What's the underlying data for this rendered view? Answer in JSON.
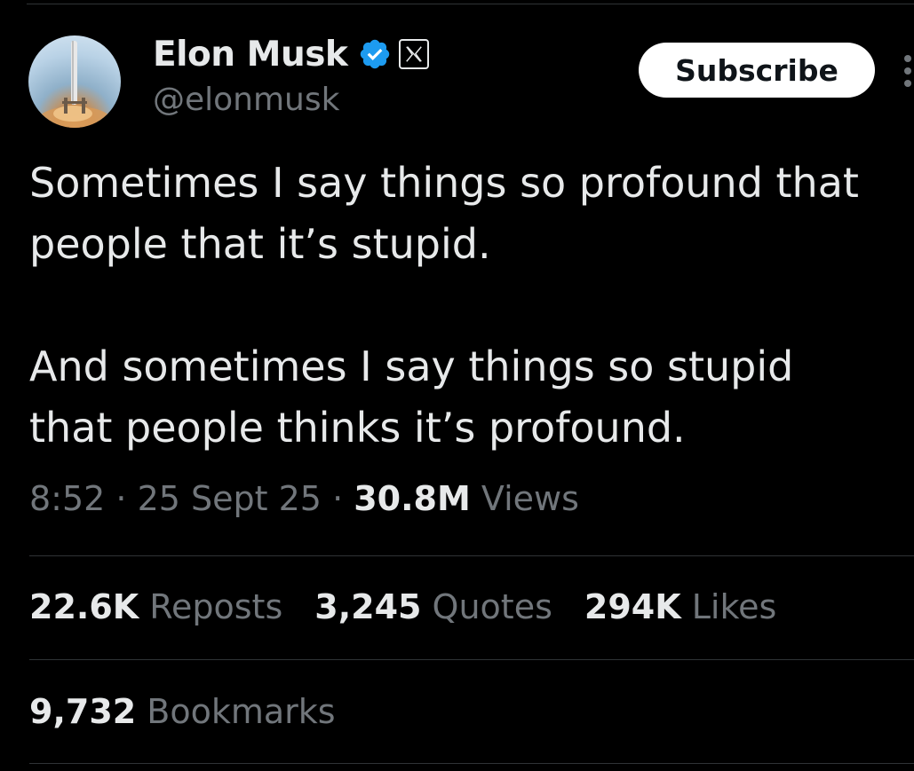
{
  "author": {
    "display_name": "Elon Musk",
    "handle": "@elonmusk",
    "verified_icon": "verified-badge-icon",
    "affiliate_icon": "x-logo-icon",
    "avatar_icon": "rocket-launch-avatar"
  },
  "header": {
    "subscribe_label": "Subscribe",
    "more_icon": "more-vertical-icon"
  },
  "tweet": {
    "line1": "Sometimes I say things so profound that",
    "line2": "people that it’s stupid.",
    "line3": "And sometimes I say things so stupid",
    "line4": "that people thinks it’s profound."
  },
  "meta": {
    "time": "8:52",
    "separator": " · ",
    "date": "25 Sept 25",
    "views_count": "30.8M",
    "views_label": "Views"
  },
  "stats": {
    "reposts_count": "22.6K",
    "reposts_label": "Reposts",
    "quotes_count": "3,245",
    "quotes_label": "Quotes",
    "likes_count": "294K",
    "likes_label": "Likes",
    "bookmarks_count": "9,732",
    "bookmarks_label": "Bookmarks"
  },
  "colors": {
    "background": "#000000",
    "primary_text": "#e7e9ea",
    "secondary_text": "#71767b",
    "divider": "#2f3336",
    "verified_blue": "#1d9bf0"
  }
}
